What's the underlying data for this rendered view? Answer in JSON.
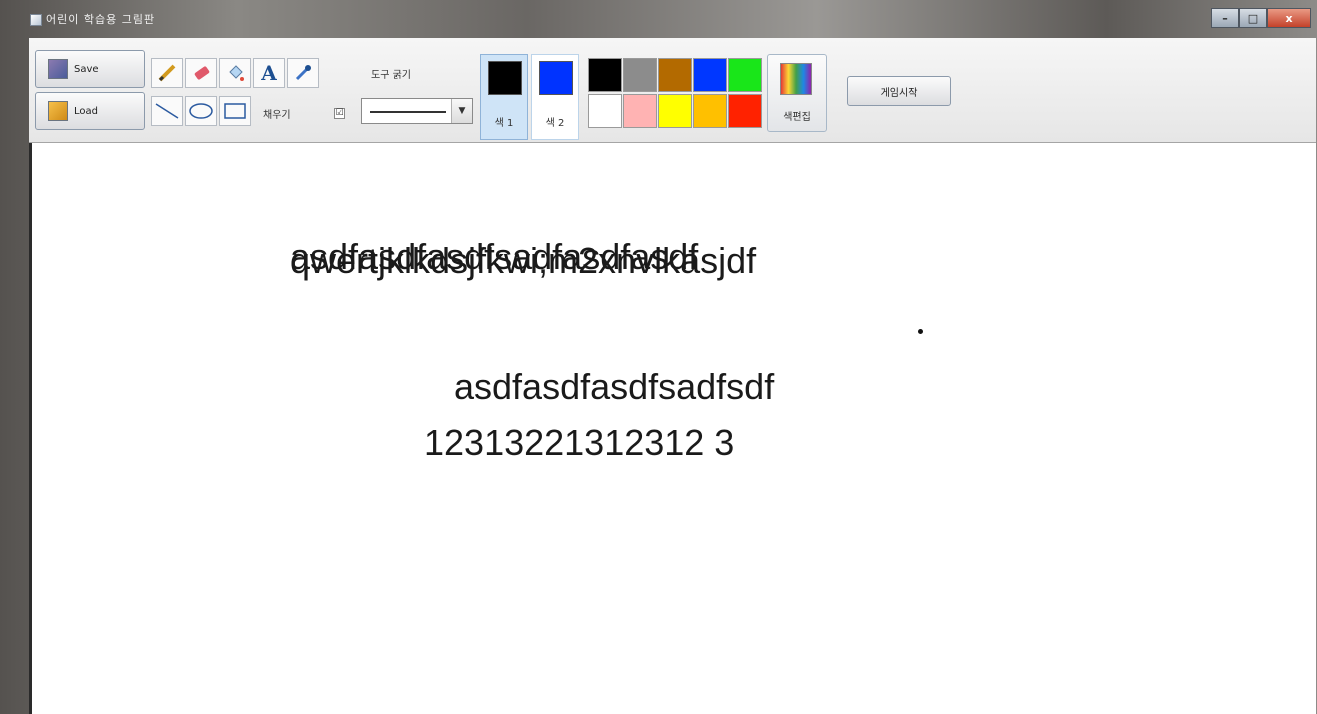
{
  "window": {
    "title": "어린이 학습용 그림판",
    "caption_buttons": {
      "minimize": "–",
      "maximize": "□",
      "close": "x"
    }
  },
  "toolbar": {
    "file_buttons": {
      "save_label": "Save",
      "load_label": "Load"
    },
    "tools": [
      {
        "name": "pencil-icon",
        "label": ""
      },
      {
        "name": "eraser-icon",
        "label": ""
      },
      {
        "name": "fill-bucket-icon",
        "label": ""
      },
      {
        "name": "text-tool-icon",
        "label": "A"
      },
      {
        "name": "eyedropper-icon",
        "label": ""
      },
      {
        "name": "line-icon",
        "label": ""
      },
      {
        "name": "ellipse-icon",
        "label": ""
      },
      {
        "name": "rectangle-icon",
        "label": ""
      }
    ],
    "fill_label": "채우기",
    "fill_checked": "☑",
    "tool_size_label": "도구 굵기",
    "stroke_arrow": "▼",
    "color1": {
      "label": "색 1",
      "color": "#000000"
    },
    "color2": {
      "label": "색 2",
      "color": "#0033ff"
    },
    "palette": [
      "#000000",
      "#8c8c8c",
      "#b36a00",
      "#0037ff",
      "#19e619",
      "#ffffff",
      "#ffb3b3",
      "#ffff00",
      "#ffc000",
      "#ff2200"
    ],
    "edit_colors_label": "색편집",
    "start_game_label": "게임시작"
  },
  "canvas": {
    "texts": [
      "qesdfjasdfjasdfsadfasdfasdf",
      "asdfasdfasdfsadfsdf",
      "12313221312312 3"
    ],
    "overlap_texts": [
      "asdfasdfasdfsadfasdfasdf",
      "qwertjklkdsjfkwi;m2xnvlkasjdf"
    ],
    "line1_text": "asdfasdfasdfsadfsdf",
    "line2_text": "12313221312312 3"
  }
}
